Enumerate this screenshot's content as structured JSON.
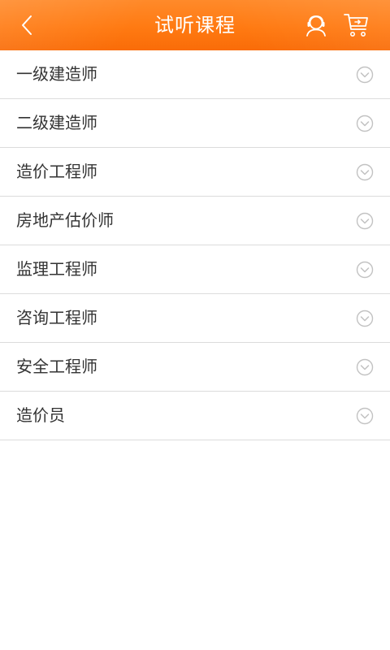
{
  "header": {
    "title": "试听课程",
    "back_icon": "chevron-left-icon",
    "service_icon": "customer-service-icon",
    "cart_icon": "shopping-cart-icon",
    "bg_color": "#ff7a12"
  },
  "courses": [
    {
      "label": "一级建造师",
      "icon": "chevron-down-circle-icon"
    },
    {
      "label": "二级建造师",
      "icon": "chevron-down-circle-icon"
    },
    {
      "label": "造价工程师",
      "icon": "chevron-down-circle-icon"
    },
    {
      "label": "房地产估价师",
      "icon": "chevron-down-circle-icon"
    },
    {
      "label": "监理工程师",
      "icon": "chevron-down-circle-icon"
    },
    {
      "label": "咨询工程师",
      "icon": "chevron-down-circle-icon"
    },
    {
      "label": "安全工程师",
      "icon": "chevron-down-circle-icon"
    },
    {
      "label": "造价员",
      "icon": "chevron-down-circle-icon"
    }
  ]
}
